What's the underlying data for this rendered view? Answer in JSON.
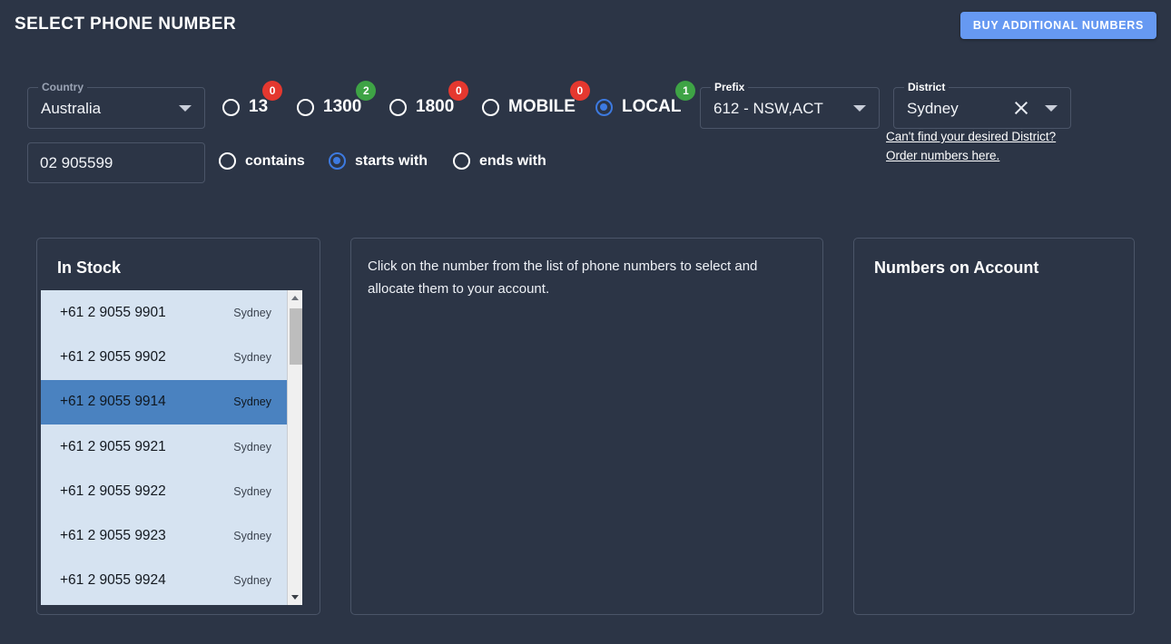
{
  "header": {
    "title": "SELECT PHONE NUMBER",
    "buy_button": "BUY ADDITIONAL NUMBERS"
  },
  "filters": {
    "country": {
      "label": "Country",
      "value": "Australia"
    },
    "prefix": {
      "label": "Prefix",
      "value": "612 - NSW,ACT"
    },
    "district": {
      "label": "District",
      "value": "Sydney"
    },
    "number_types": [
      {
        "label": "13",
        "count": "0",
        "count_color": "#e5382f",
        "selected": false
      },
      {
        "label": "1300",
        "count": "2",
        "count_color": "#3ea345",
        "selected": false
      },
      {
        "label": "1800",
        "count": "0",
        "count_color": "#e5382f",
        "selected": false
      },
      {
        "label": "MOBILE",
        "count": "0",
        "count_color": "#e5382f",
        "selected": false
      },
      {
        "label": "LOCAL",
        "count": "1",
        "count_color": "#3ea345",
        "selected": true
      }
    ],
    "district_links": [
      "Can't find your desired District?",
      "Order numbers here."
    ],
    "search": {
      "value": "02 905599",
      "placeholder": "",
      "match_modes": [
        {
          "label": "contains",
          "selected": false
        },
        {
          "label": "starts with",
          "selected": true
        },
        {
          "label": "ends with",
          "selected": false
        }
      ]
    }
  },
  "in_stock": {
    "title": "In Stock",
    "rows": [
      {
        "number": "+61 2 9055 9901",
        "district": "Sydney",
        "selected": false
      },
      {
        "number": "+61 2 9055 9902",
        "district": "Sydney",
        "selected": false
      },
      {
        "number": "+61 2 9055 9914",
        "district": "Sydney",
        "selected": true
      },
      {
        "number": "+61 2 9055 9921",
        "district": "Sydney",
        "selected": false
      },
      {
        "number": "+61 2 9055 9922",
        "district": "Sydney",
        "selected": false
      },
      {
        "number": "+61 2 9055 9923",
        "district": "Sydney",
        "selected": false
      },
      {
        "number": "+61 2 9055 9924",
        "district": "Sydney",
        "selected": false
      }
    ]
  },
  "instructions": {
    "text": "Click on the number from the list of phone numbers to select and allocate them to your account."
  },
  "numbers_on_account": {
    "title": "Numbers on Account",
    "rows": []
  },
  "icons": {
    "chevron_down": "chevron-down-icon",
    "clear": "close-icon",
    "scroll_up": "scroll-up-arrow-icon",
    "scroll_down": "scroll-down-arrow-icon"
  },
  "colors": {
    "background": "#2c3546",
    "accent": "#6699f2",
    "selected_row": "#4a82c0",
    "list_background": "#d6e3f1"
  }
}
